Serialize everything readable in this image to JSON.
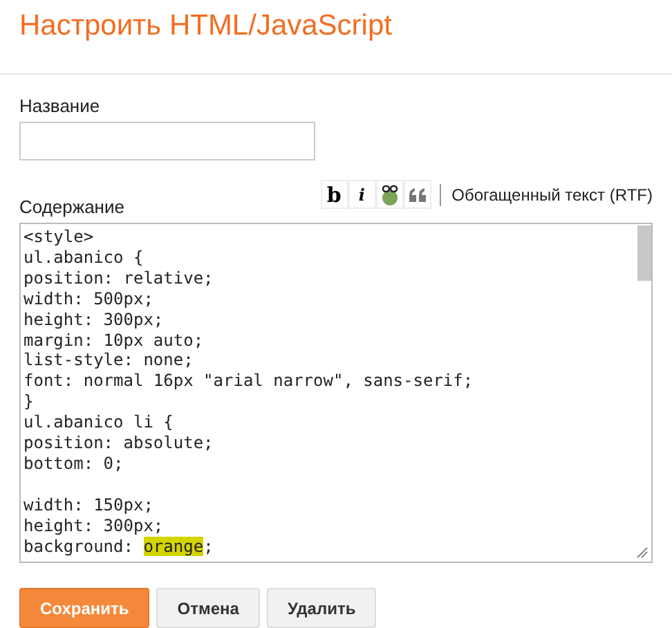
{
  "title": "Настроить HTML/JavaScript",
  "name_field": {
    "label": "Название"
  },
  "content": {
    "label": "Содержание",
    "toolbar": [
      {
        "kind": "bold",
        "label": "b"
      },
      {
        "kind": "italic",
        "label": "i"
      },
      {
        "kind": "link"
      },
      {
        "kind": "quote"
      }
    ],
    "rtf_link": "Обогащенный текст (RTF)",
    "lines": [
      {
        "text": "<style>"
      },
      {
        "text": "ul.abanico {"
      },
      {
        "text": "position: relative;"
      },
      {
        "text": "width: 500px;"
      },
      {
        "text": "height: 300px;"
      },
      {
        "text": "margin: 10px auto;"
      },
      {
        "text": "list-style: none;"
      },
      {
        "text": "font: normal 16px \"arial narrow\", sans-serif;"
      },
      {
        "text": "}"
      },
      {
        "text": "ul.abanico li {"
      },
      {
        "text": "position: absolute;"
      },
      {
        "text": "bottom: 0;"
      },
      {
        "kind": "blank"
      },
      {
        "text": "width: 150px;"
      },
      {
        "text": "height: 300px;"
      },
      {
        "segments": [
          {
            "text": "background: ",
            "highlighted": false
          },
          {
            "text": "orange",
            "highlighted": true
          },
          {
            "text": ";",
            "highlighted": false
          }
        ]
      }
    ]
  },
  "buttons": [
    {
      "label": "Сохранить",
      "primary": true
    },
    {
      "label": "Отмена",
      "primary": false
    },
    {
      "label": "Удалить",
      "primary": false
    }
  ]
}
